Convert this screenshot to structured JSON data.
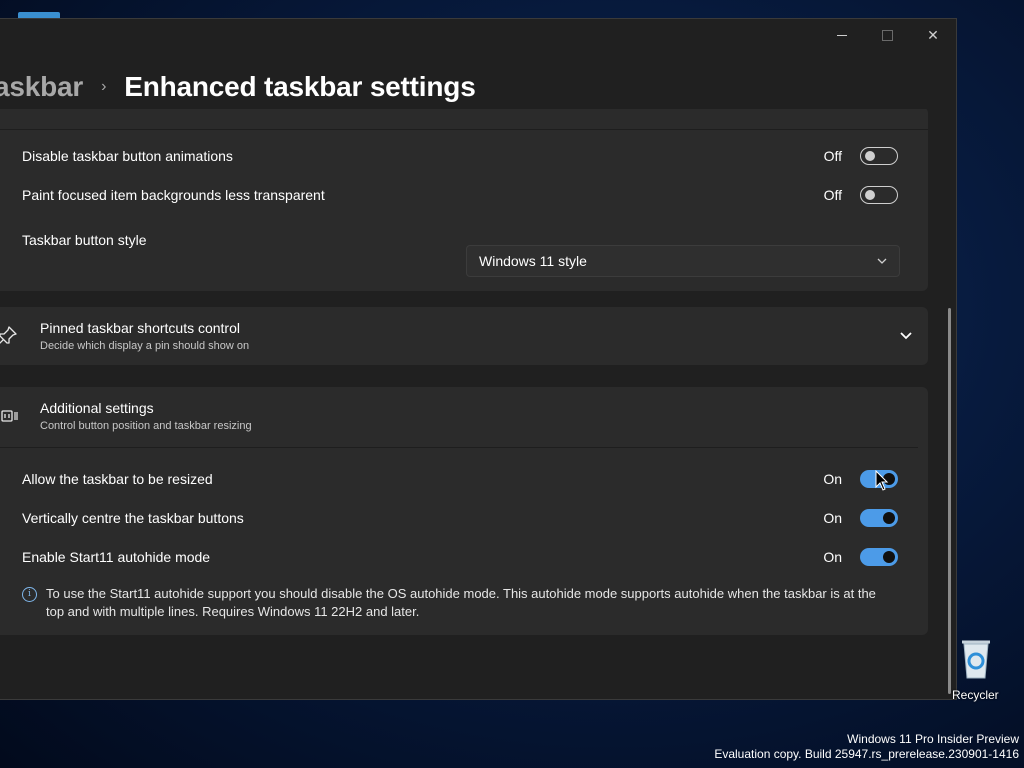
{
  "window": {
    "breadcrumb_parent": "askbar",
    "breadcrumb_separator": "›",
    "title": "Enhanced taskbar settings",
    "close_glyph": "✕"
  },
  "section1": {
    "rows": [
      {
        "label": "Disable taskbar button animations",
        "state": "Off",
        "on": false
      },
      {
        "label": "Paint focused item backgrounds less transparent",
        "state": "Off",
        "on": false
      }
    ],
    "button_style_label": "Taskbar button style",
    "button_style_value": "Windows 11 style"
  },
  "pinned": {
    "title": "Pinned taskbar shortcuts control",
    "subtitle": "Decide which display a pin should show on",
    "icon": "pin-icon"
  },
  "additional": {
    "title": "Additional settings",
    "subtitle": "Control button position and taskbar resizing",
    "icon": "resize-icon",
    "rows": [
      {
        "label": "Allow the taskbar to be resized",
        "state": "On",
        "on": true
      },
      {
        "label": "Vertically centre the taskbar buttons",
        "state": "On",
        "on": true
      },
      {
        "label": "Enable Start11 autohide mode",
        "state": "On",
        "on": true
      }
    ],
    "info_text": "To use the Start11 autohide support you should disable the OS autohide mode.  This autohide mode supports autohide when the taskbar is at the top and with multiple lines.  Requires Windows 11 22H2 and later."
  },
  "desktop": {
    "recycle_label": "Recycler",
    "watermark_line1": "Windows 11 Pro Insider Preview",
    "watermark_line2": "Evaluation copy. Build 25947.rs_prerelease.230901-1416"
  },
  "colors": {
    "accent": "#4c9be8",
    "window_bg": "#202020",
    "card_bg": "#2b2b2b"
  }
}
